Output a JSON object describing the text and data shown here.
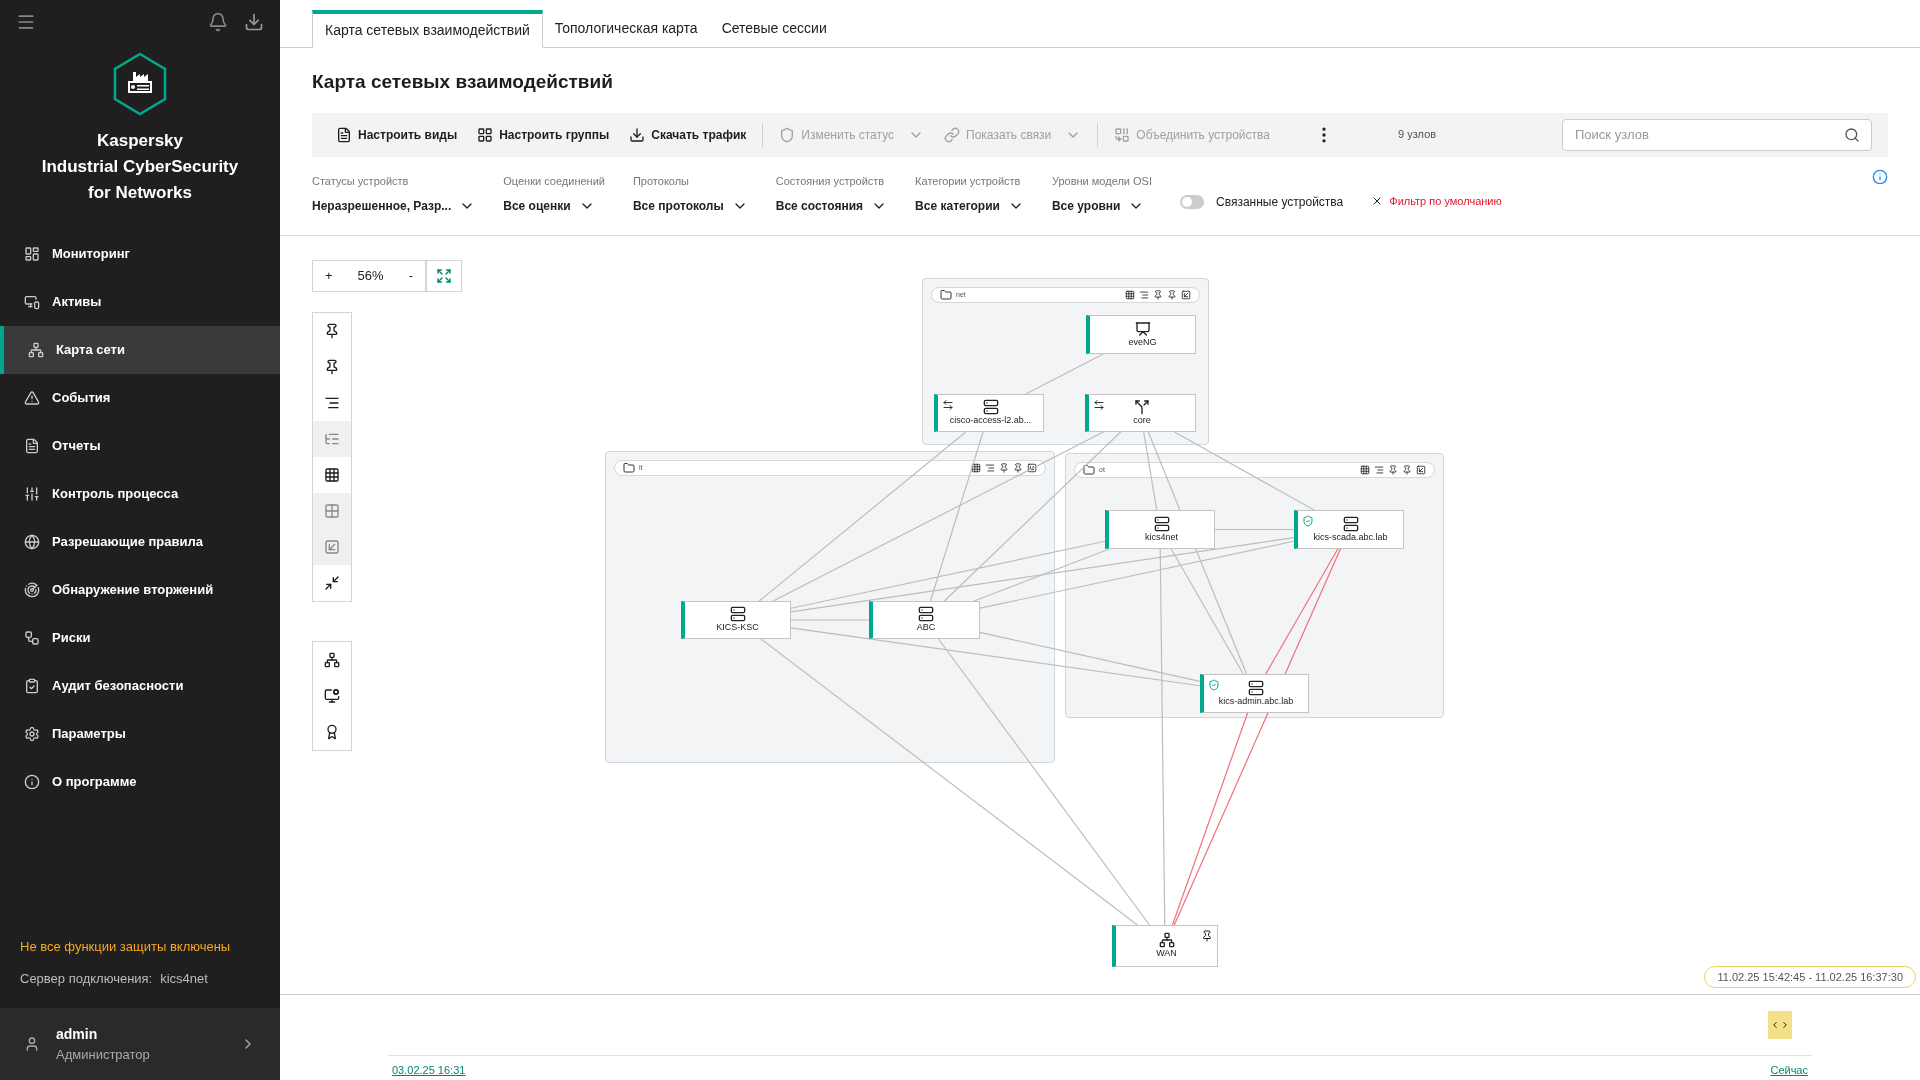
{
  "sidebar": {
    "product": [
      "Kaspersky",
      "Industrial CyberSecurity",
      "for Networks"
    ],
    "items": [
      {
        "label": "Мониторинг",
        "selected": false
      },
      {
        "label": "Активы",
        "selected": false
      },
      {
        "label": "Карта сети",
        "selected": true
      },
      {
        "label": "События",
        "selected": false
      },
      {
        "label": "Отчеты",
        "selected": false
      },
      {
        "label": "Контроль процесса",
        "selected": false
      },
      {
        "label": "Разрешающие правила",
        "selected": false
      },
      {
        "label": "Обнаружение вторжений",
        "selected": false
      },
      {
        "label": "Риски",
        "selected": false
      },
      {
        "label": "Аудит безопасности",
        "selected": false
      },
      {
        "label": "Параметры",
        "selected": false
      },
      {
        "label": "О программе",
        "selected": false
      }
    ],
    "warning": "Не все функции защиты включены",
    "server_label": "Сервер подключения:",
    "server": "kics4net",
    "user": {
      "name": "admin",
      "role": "Администратор"
    }
  },
  "tabs": [
    {
      "label": "Карта сетевых взаимодействий",
      "selected": true
    },
    {
      "label": "Топологическая карта",
      "selected": false
    },
    {
      "label": "Сетевые сессии",
      "selected": false
    }
  ],
  "title": "Карта сетевых взаимодействий",
  "toolbar": {
    "buttons": [
      {
        "label": "Настроить виды",
        "disabled": false,
        "dropdown": false
      },
      {
        "label": "Настроить группы",
        "disabled": false,
        "dropdown": false
      },
      {
        "label": "Скачать трафик",
        "disabled": false,
        "dropdown": false
      },
      {
        "label": "Изменить статус",
        "disabled": true,
        "dropdown": true
      },
      {
        "label": "Показать связи",
        "disabled": true,
        "dropdown": true
      },
      {
        "label": "Объединить устройства",
        "disabled": true,
        "dropdown": false
      }
    ],
    "count": "9 узлов",
    "search": {
      "placeholder": "Поиск узлов"
    }
  },
  "filters": [
    {
      "label": "Статусы устройств",
      "value": "Неразрешенное, Разр..."
    },
    {
      "label": "Оценки соединений",
      "value": "Все оценки"
    },
    {
      "label": "Протоколы",
      "value": "Все протоколы"
    },
    {
      "label": "Состояния устройств",
      "value": "Все состояния"
    },
    {
      "label": "Категории устройств",
      "value": "Все категории"
    },
    {
      "label": "Уровни модели OSI",
      "value": "Все уровни"
    }
  ],
  "linked_toggle": {
    "label": "Связанные устройства",
    "on": false
  },
  "reset_filter": "Фильтр по умолчанию",
  "map": {
    "zoom": {
      "plus": "+",
      "value": "56%",
      "minus": "-"
    },
    "tools": [
      {
        "disabled": false
      },
      {
        "disabled": false
      },
      {
        "disabled": false
      },
      {
        "disabled": true
      },
      {
        "disabled": false
      },
      {
        "disabled": true
      },
      {
        "disabled": true
      },
      {
        "disabled": false
      }
    ],
    "tools2": [
      {
        "disabled": false
      },
      {
        "disabled": false
      },
      {
        "disabled": false
      }
    ],
    "groups": [
      {
        "name": "net"
      },
      {
        "name": "it"
      },
      {
        "name": "ot"
      }
    ],
    "nodes": [
      {
        "name": "eveNG",
        "kind": "unknown",
        "protected": false,
        "arrows": false
      },
      {
        "name": "cisco-access-l2.ab...",
        "kind": "switch",
        "protected": false,
        "arrows": true
      },
      {
        "name": "core",
        "kind": "router",
        "protected": false,
        "arrows": true
      },
      {
        "name": "kics4net",
        "kind": "server",
        "protected": false,
        "arrows": false
      },
      {
        "name": "kics-scada.abc.lab",
        "kind": "server",
        "protected": true,
        "arrows": false
      },
      {
        "name": "KICS-KSC",
        "kind": "server",
        "protected": false,
        "arrows": false
      },
      {
        "name": "ABC",
        "kind": "server",
        "protected": false,
        "arrows": false
      },
      {
        "name": "kics-admin.abc.lab",
        "kind": "server",
        "protected": true,
        "arrows": false
      },
      {
        "name": "WAN",
        "kind": "network",
        "protected": false,
        "arrows": false
      }
    ]
  },
  "timeline": {
    "range": "11.02.25 15:42:45 - 11.02.25 16:37:30",
    "start": "03.02.25 16:31",
    "end": "Сейчас"
  }
}
